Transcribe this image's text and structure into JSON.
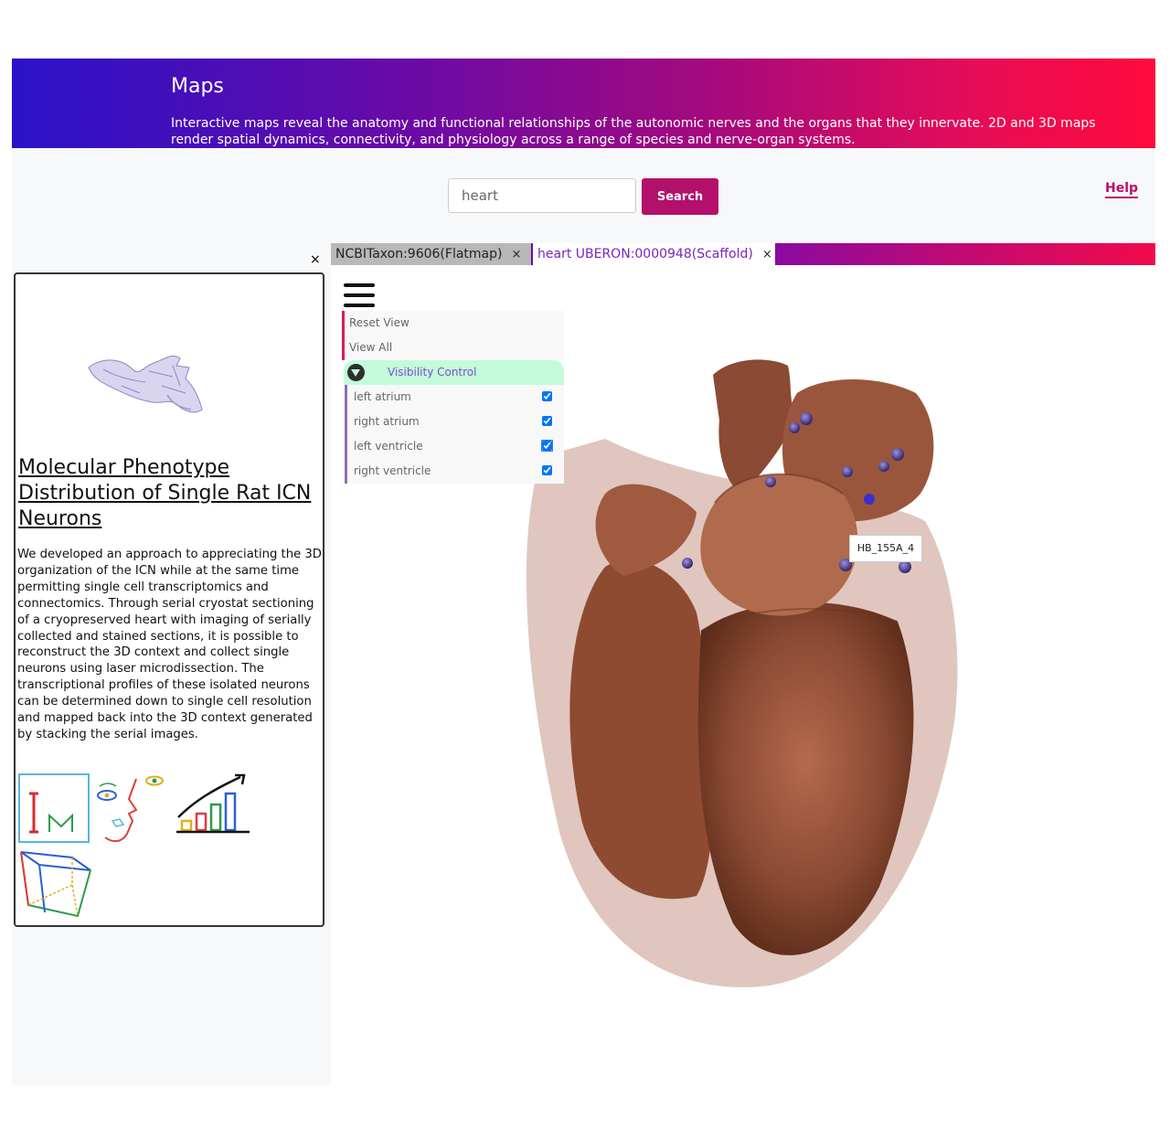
{
  "banner": {
    "title": "Maps",
    "description": "Interactive maps reveal the anatomy and functional relationships of the autonomic nerves and the organs that they innervate. 2D and 3D maps render spatial dynamics, connectivity, and physiology across a range of species and nerve-organ systems.",
    "gradient_colors": [
      "#2a12c9",
      "#6a0aa6",
      "#e80c56",
      "#ff0a3c"
    ]
  },
  "search": {
    "value": "heart",
    "button_label": "Search"
  },
  "help": {
    "label": "Help"
  },
  "panel": {
    "close_label": "×"
  },
  "tabs": [
    {
      "label": "NCBITaxon:9606(Flatmap)",
      "close": "×",
      "active": false
    },
    {
      "label": "heart UBERON:0000948(Scaffold)",
      "close": "×",
      "active": true
    }
  ],
  "info": {
    "title": "Molecular Phenotype Distribution of Single Rat ICN Neurons",
    "description": "We developed an approach to appreciating the 3D organization of the ICN while at the same time permitting single cell transcriptomics and connectomics. Through serial cryostat sectioning of a cryopreserved heart with imaging of serially collected and stained sections, it is possible to reconstruct the 3D context and collect single neurons using laser microdissection. The transcriptional profiles of these isolated neurons can be determined down to single cell resolution and mapped back into the 3D context generated by stacking the serial images.",
    "icons": [
      "image-viewer-icon",
      "face-viewer-icon",
      "plot-viewer-icon",
      "scaffold-viewer-icon"
    ],
    "icon_text": "IM"
  },
  "menu": {
    "reset_view": "Reset View",
    "view_all": "View All",
    "visibility_control": "Visibility Control",
    "regions": [
      {
        "label": "left atrium",
        "checked": true
      },
      {
        "label": "right atrium",
        "checked": true
      },
      {
        "label": "left ventricle",
        "checked": true
      },
      {
        "label": "right ventricle",
        "checked": true
      }
    ]
  },
  "viewer": {
    "tooltip": "HB_155A_4",
    "heart_color": "#8a4a33",
    "marker_color": "#4a3d8f"
  }
}
